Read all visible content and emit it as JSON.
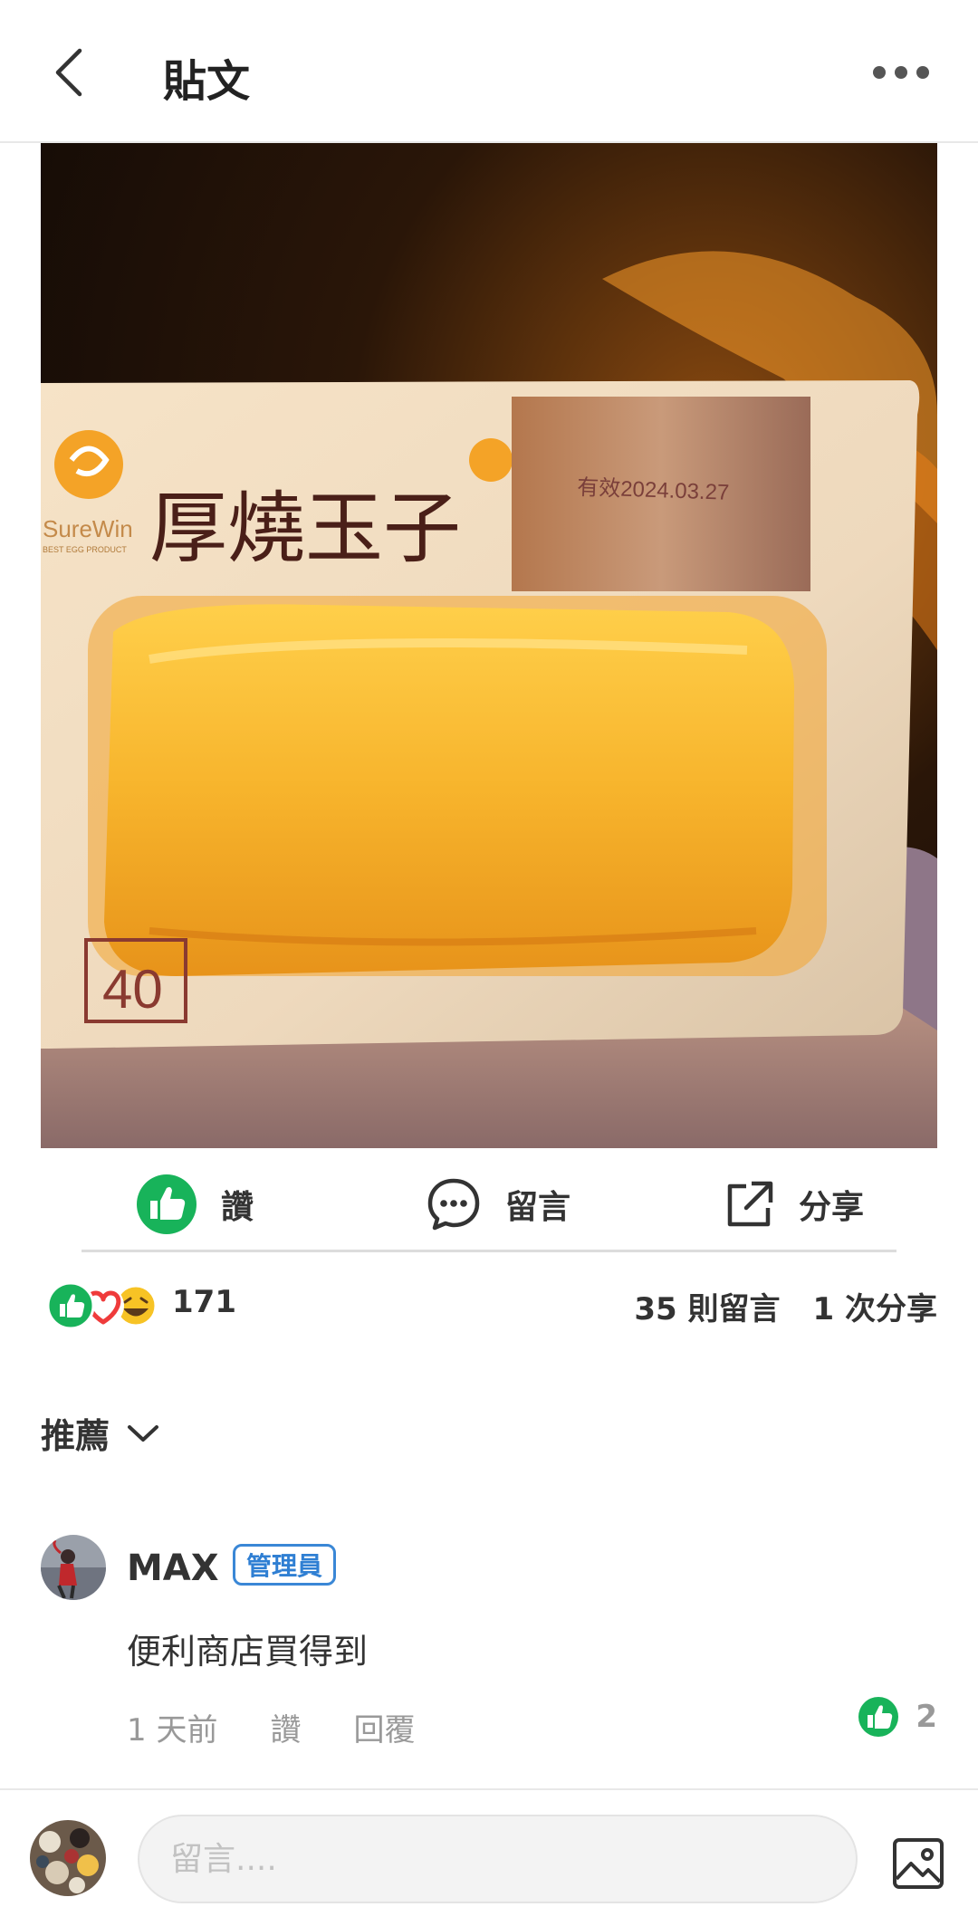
{
  "header": {
    "title": "貼文"
  },
  "post": {
    "photo_text": {
      "brand": "SureWin",
      "brand_sub": "BEST EGG PRODUCT",
      "product_name": "厚燒玉子",
      "date_stamp": "有效2024.03.27",
      "number": "40"
    }
  },
  "actions": {
    "like": "讚",
    "comment": "留言",
    "share": "分享"
  },
  "stats": {
    "reaction_count": "171",
    "comments": "35 則留言",
    "shares": "1 次分享"
  },
  "sort": {
    "label": "推薦"
  },
  "comment": {
    "author": "MAX",
    "badge": "管理員",
    "text": "便利商店買得到",
    "time": "1 天前",
    "like_label": "讚",
    "reply_label": "回覆",
    "like_count": "2"
  },
  "composer": {
    "placeholder": "留言...."
  },
  "colors": {
    "like_green": "#18b35a",
    "love_red": "#ef3b3b",
    "haha_yellow": "#f7c325",
    "badge_blue": "#2f7fd3"
  },
  "icons": [
    "back-icon",
    "more-icon",
    "like-icon",
    "comment-icon",
    "share-icon",
    "chevron-down-icon",
    "image-icon"
  ]
}
